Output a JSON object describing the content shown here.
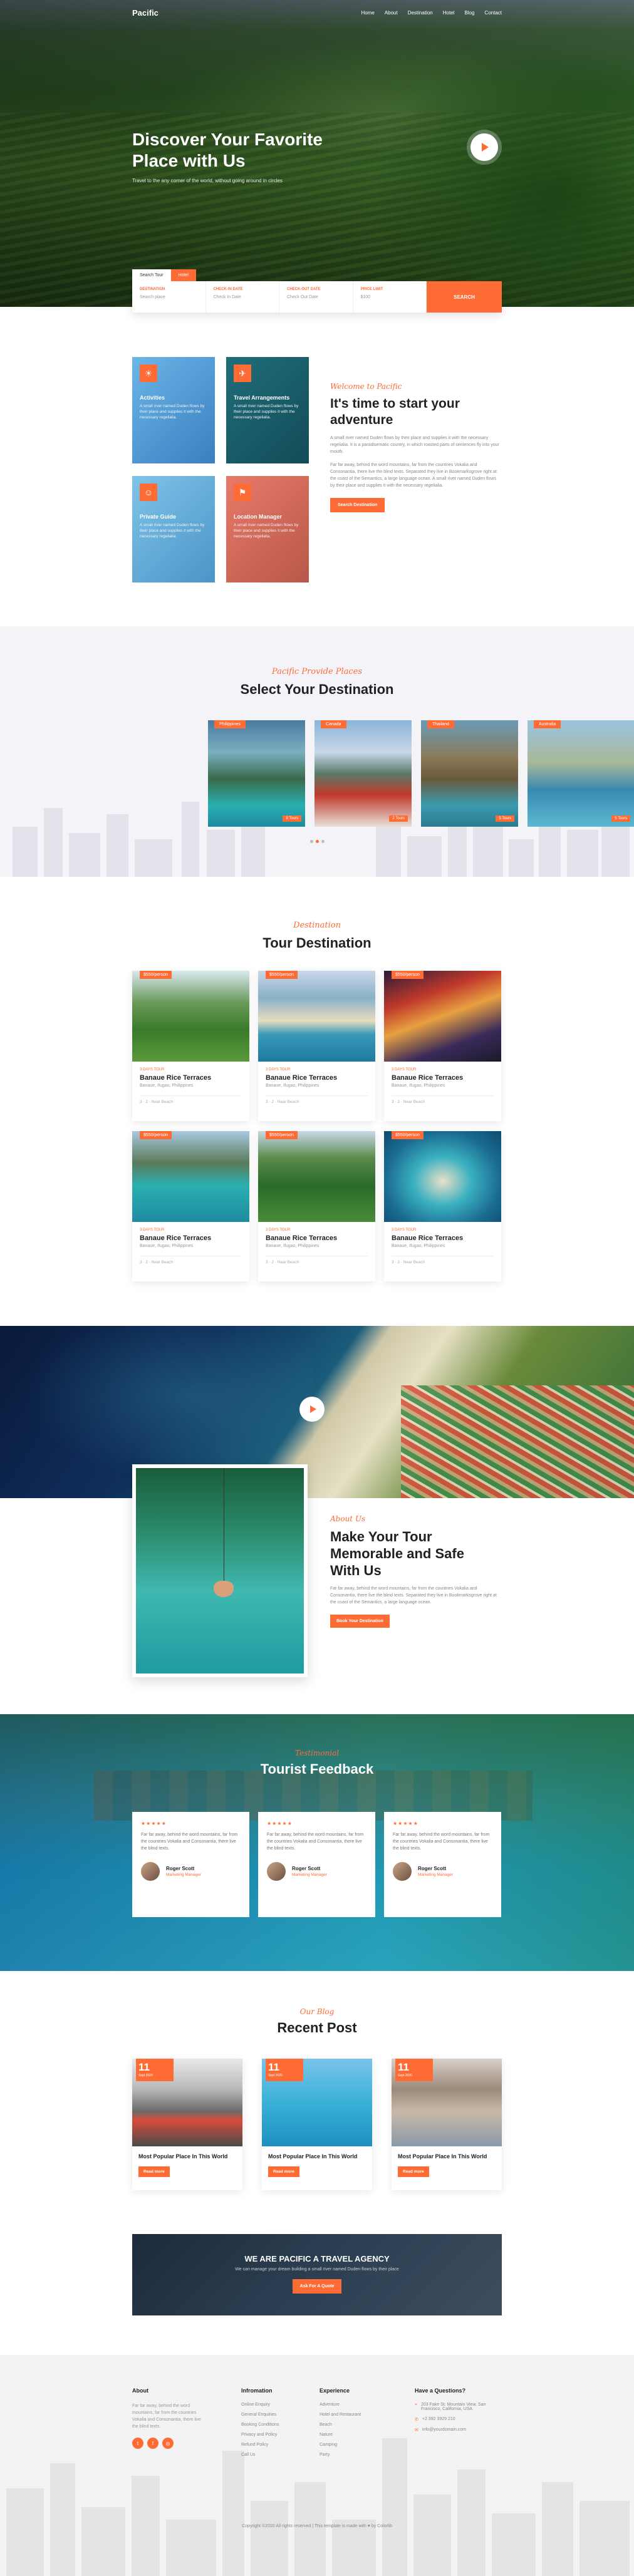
{
  "nav": {
    "logo": "Pacific",
    "links": [
      "Home",
      "About",
      "Destination",
      "Hotel",
      "Blog",
      "Contact"
    ]
  },
  "hero": {
    "title_line1": "Discover Your Favorite",
    "title_line2": "Place with Us",
    "subtitle": "Travel to the any corner of the world, without going around in circles"
  },
  "search": {
    "tab1": "Search Tour",
    "tab2": "Hotel",
    "fields": [
      {
        "label": "DESTINATION",
        "value": "Search place"
      },
      {
        "label": "CHECK-IN DATE",
        "value": "Check In Date"
      },
      {
        "label": "CHECK-OUT DATE",
        "value": "Check Out Date"
      },
      {
        "label": "PRICE LIMIT",
        "value": "$100"
      }
    ],
    "button": "SEARCH"
  },
  "features": [
    {
      "title": "Activities",
      "text": "A small river named Duden flows by their place and supplies it with the necessary regelialia.",
      "icon": "activity-icon"
    },
    {
      "title": "Travel Arrangements",
      "text": "A small river named Duden flows by their place and supplies it with the necessary regelialia.",
      "icon": "travel-icon"
    },
    {
      "title": "Private Guide",
      "text": "A small river named Duden flows by their place and supplies it with the necessary regelialia.",
      "icon": "guide-icon"
    },
    {
      "title": "Location Manager",
      "text": "A small river named Duden flows by their place and supplies it with the necessary regelialia.",
      "icon": "map-icon"
    }
  ],
  "about": {
    "script": "Welcome to Pacific",
    "title_line1": "It's time to start your",
    "title_line2": "adventure",
    "p1": "A small river named Duden flows by their place and supplies it with the necessary regelialia. It is a paradisematic country, in which roasted parts of sentences fly into your mouth.",
    "p2": "Far far away, behind the word mountains, far from the countries Vokalia and Consonantia, there live the blind texts. Separated they live in Bookmarksgrove right at the coast of the Semantics, a large language ocean. A small river named Duden flows by their place and supplies it with the necessary regelialia.",
    "button": "Search Destination"
  },
  "destinations": {
    "script": "Pacific Provide Places",
    "title": "Select Your Destination",
    "items": [
      {
        "name": "Philippines",
        "tours": "8 Tours"
      },
      {
        "name": "Canada",
        "tours": "2 Tours"
      },
      {
        "name": "Thailand",
        "tours": "5 Tours"
      },
      {
        "name": "Australia",
        "tours": "5 Tours"
      }
    ]
  },
  "tours": {
    "script": "Destination",
    "title": "Tour Destination",
    "items": [
      {
        "price": "$550/person",
        "cat": "3 DAYS TOUR",
        "name": "Banaue Rice Terraces",
        "loc": "Banaue, Ifugao, Philippines",
        "meta": "3 · 2 · Near Beach"
      },
      {
        "price": "$550/person",
        "cat": "3 DAYS TOUR",
        "name": "Banaue Rice Terraces",
        "loc": "Banaue, Ifugao, Philippines",
        "meta": "3 · 2 · Near Beach"
      },
      {
        "price": "$550/person",
        "cat": "3 DAYS TOUR",
        "name": "Banaue Rice Terraces",
        "loc": "Banaue, Ifugao, Philippines",
        "meta": "3 · 2 · Near Beach"
      },
      {
        "price": "$550/person",
        "cat": "3 DAYS TOUR",
        "name": "Banaue Rice Terraces",
        "loc": "Banaue, Ifugao, Philippines",
        "meta": "3 · 2 · Near Beach"
      },
      {
        "price": "$550/person",
        "cat": "3 DAYS TOUR",
        "name": "Banaue Rice Terraces",
        "loc": "Banaue, Ifugao, Philippines",
        "meta": "3 · 2 · Near Beach"
      },
      {
        "price": "$550/person",
        "cat": "3 DAYS TOUR",
        "name": "Banaue Rice Terraces",
        "loc": "Banaue, Ifugao, Philippines",
        "meta": "3 · 2 · Near Beach"
      }
    ]
  },
  "video": {
    "script": "About Us",
    "title_line1": "Make Your Tour",
    "title_line2": "Memorable and Safe",
    "title_line3": "With Us",
    "text": "Far far away, behind the word mountains, far from the countries Vokalia and Consonantia, there live the blind texts. Separated they live in Bookmarksgrove right at the coast of the Semantics, a large language ocean.",
    "button": "Book Your Destination"
  },
  "testimonials": {
    "script": "Testimonial",
    "title": "Tourist Feedback",
    "items": [
      {
        "stars": "★★★★★",
        "text": "Far far away, behind the word mountains, far from the countries Vokalia and Consonantia, there live the blind texts.",
        "name": "Roger Scott",
        "role": "Marketing Manager"
      },
      {
        "stars": "★★★★★",
        "text": "Far far away, behind the word mountains, far from the countries Vokalia and Consonantia, there live the blind texts.",
        "name": "Roger Scott",
        "role": "Marketing Manager"
      },
      {
        "stars": "★★★★★",
        "text": "Far far away, behind the word mountains, far from the countries Vokalia and Consonantia, there live the blind texts.",
        "name": "Roger Scott",
        "role": "Marketing Manager"
      }
    ]
  },
  "blog": {
    "script": "Our Blog",
    "title": "Recent Post",
    "items": [
      {
        "day": "11",
        "month": "Sept 2020",
        "title": "Most Popular Place In This World",
        "button": "Read more"
      },
      {
        "day": "11",
        "month": "Sept 2020",
        "title": "Most Popular Place In This World",
        "button": "Read more"
      },
      {
        "day": "11",
        "month": "Sept 2020",
        "title": "Most Popular Place In This World",
        "button": "Read more"
      }
    ]
  },
  "cta": {
    "title": "WE ARE PACIFIC A TRAVEL AGENCY",
    "text": "We can manage your dream building a small river named Duden flows by their place",
    "button": "Ask For A Quote"
  },
  "footer": {
    "about_title": "About",
    "about_text": "Far far away, behind the word mountains, far from the countries Vokalia and Consonantia, there live the blind texts.",
    "info_title": "Infromation",
    "info_links": [
      "Online Enquiry",
      "General Enquiries",
      "Booking Conditions",
      "Privacy and Policy",
      "Refund Policy",
      "Call Us"
    ],
    "exp_title": "Experience",
    "exp_links": [
      "Adventure",
      "Hotel and Restaurant",
      "Beach",
      "Nature",
      "Camping",
      "Party"
    ],
    "contact_title": "Have a Questions?",
    "contact": [
      "203 Fake St. Mountain View, San Francisco, California, USA",
      "+2 392 3929 210",
      "info@yourdomain.com"
    ],
    "copyright": "Copyright ©2020 All rights reserved | This template is made with ♥ by Colorlib"
  }
}
